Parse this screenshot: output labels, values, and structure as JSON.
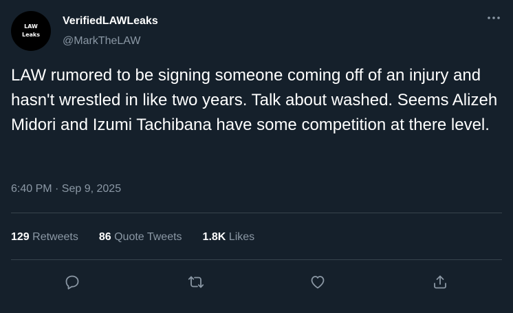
{
  "author": {
    "avatar_line1": "LAW",
    "avatar_line2": "Leaks",
    "display_name": "VerifiedLAWLeaks",
    "handle": "@MarkTheLAW"
  },
  "tweet": {
    "text": "LAW rumored to be signing someone coming off of an injury and hasn't wrestled in like two years. Talk about washed. Seems Alizeh Midori and Izumi Tachibana have some competition at there level.",
    "timestamp": "6:40 PM · Sep 9, 2025"
  },
  "stats": {
    "retweets_count": "129",
    "retweets_label": "Retweets",
    "quotes_count": "86",
    "quotes_label": "Quote Tweets",
    "likes_count": "1.8K",
    "likes_label": "Likes"
  },
  "actions": {
    "reply_icon": "reply-icon",
    "retweet_icon": "retweet-icon",
    "like_icon": "heart-icon",
    "share_icon": "share-icon",
    "more_icon": "more-dots-icon"
  },
  "colors": {
    "background": "#15202b",
    "text_primary": "#ffffff",
    "text_secondary": "#8b98a5",
    "divider": "#38444d"
  }
}
